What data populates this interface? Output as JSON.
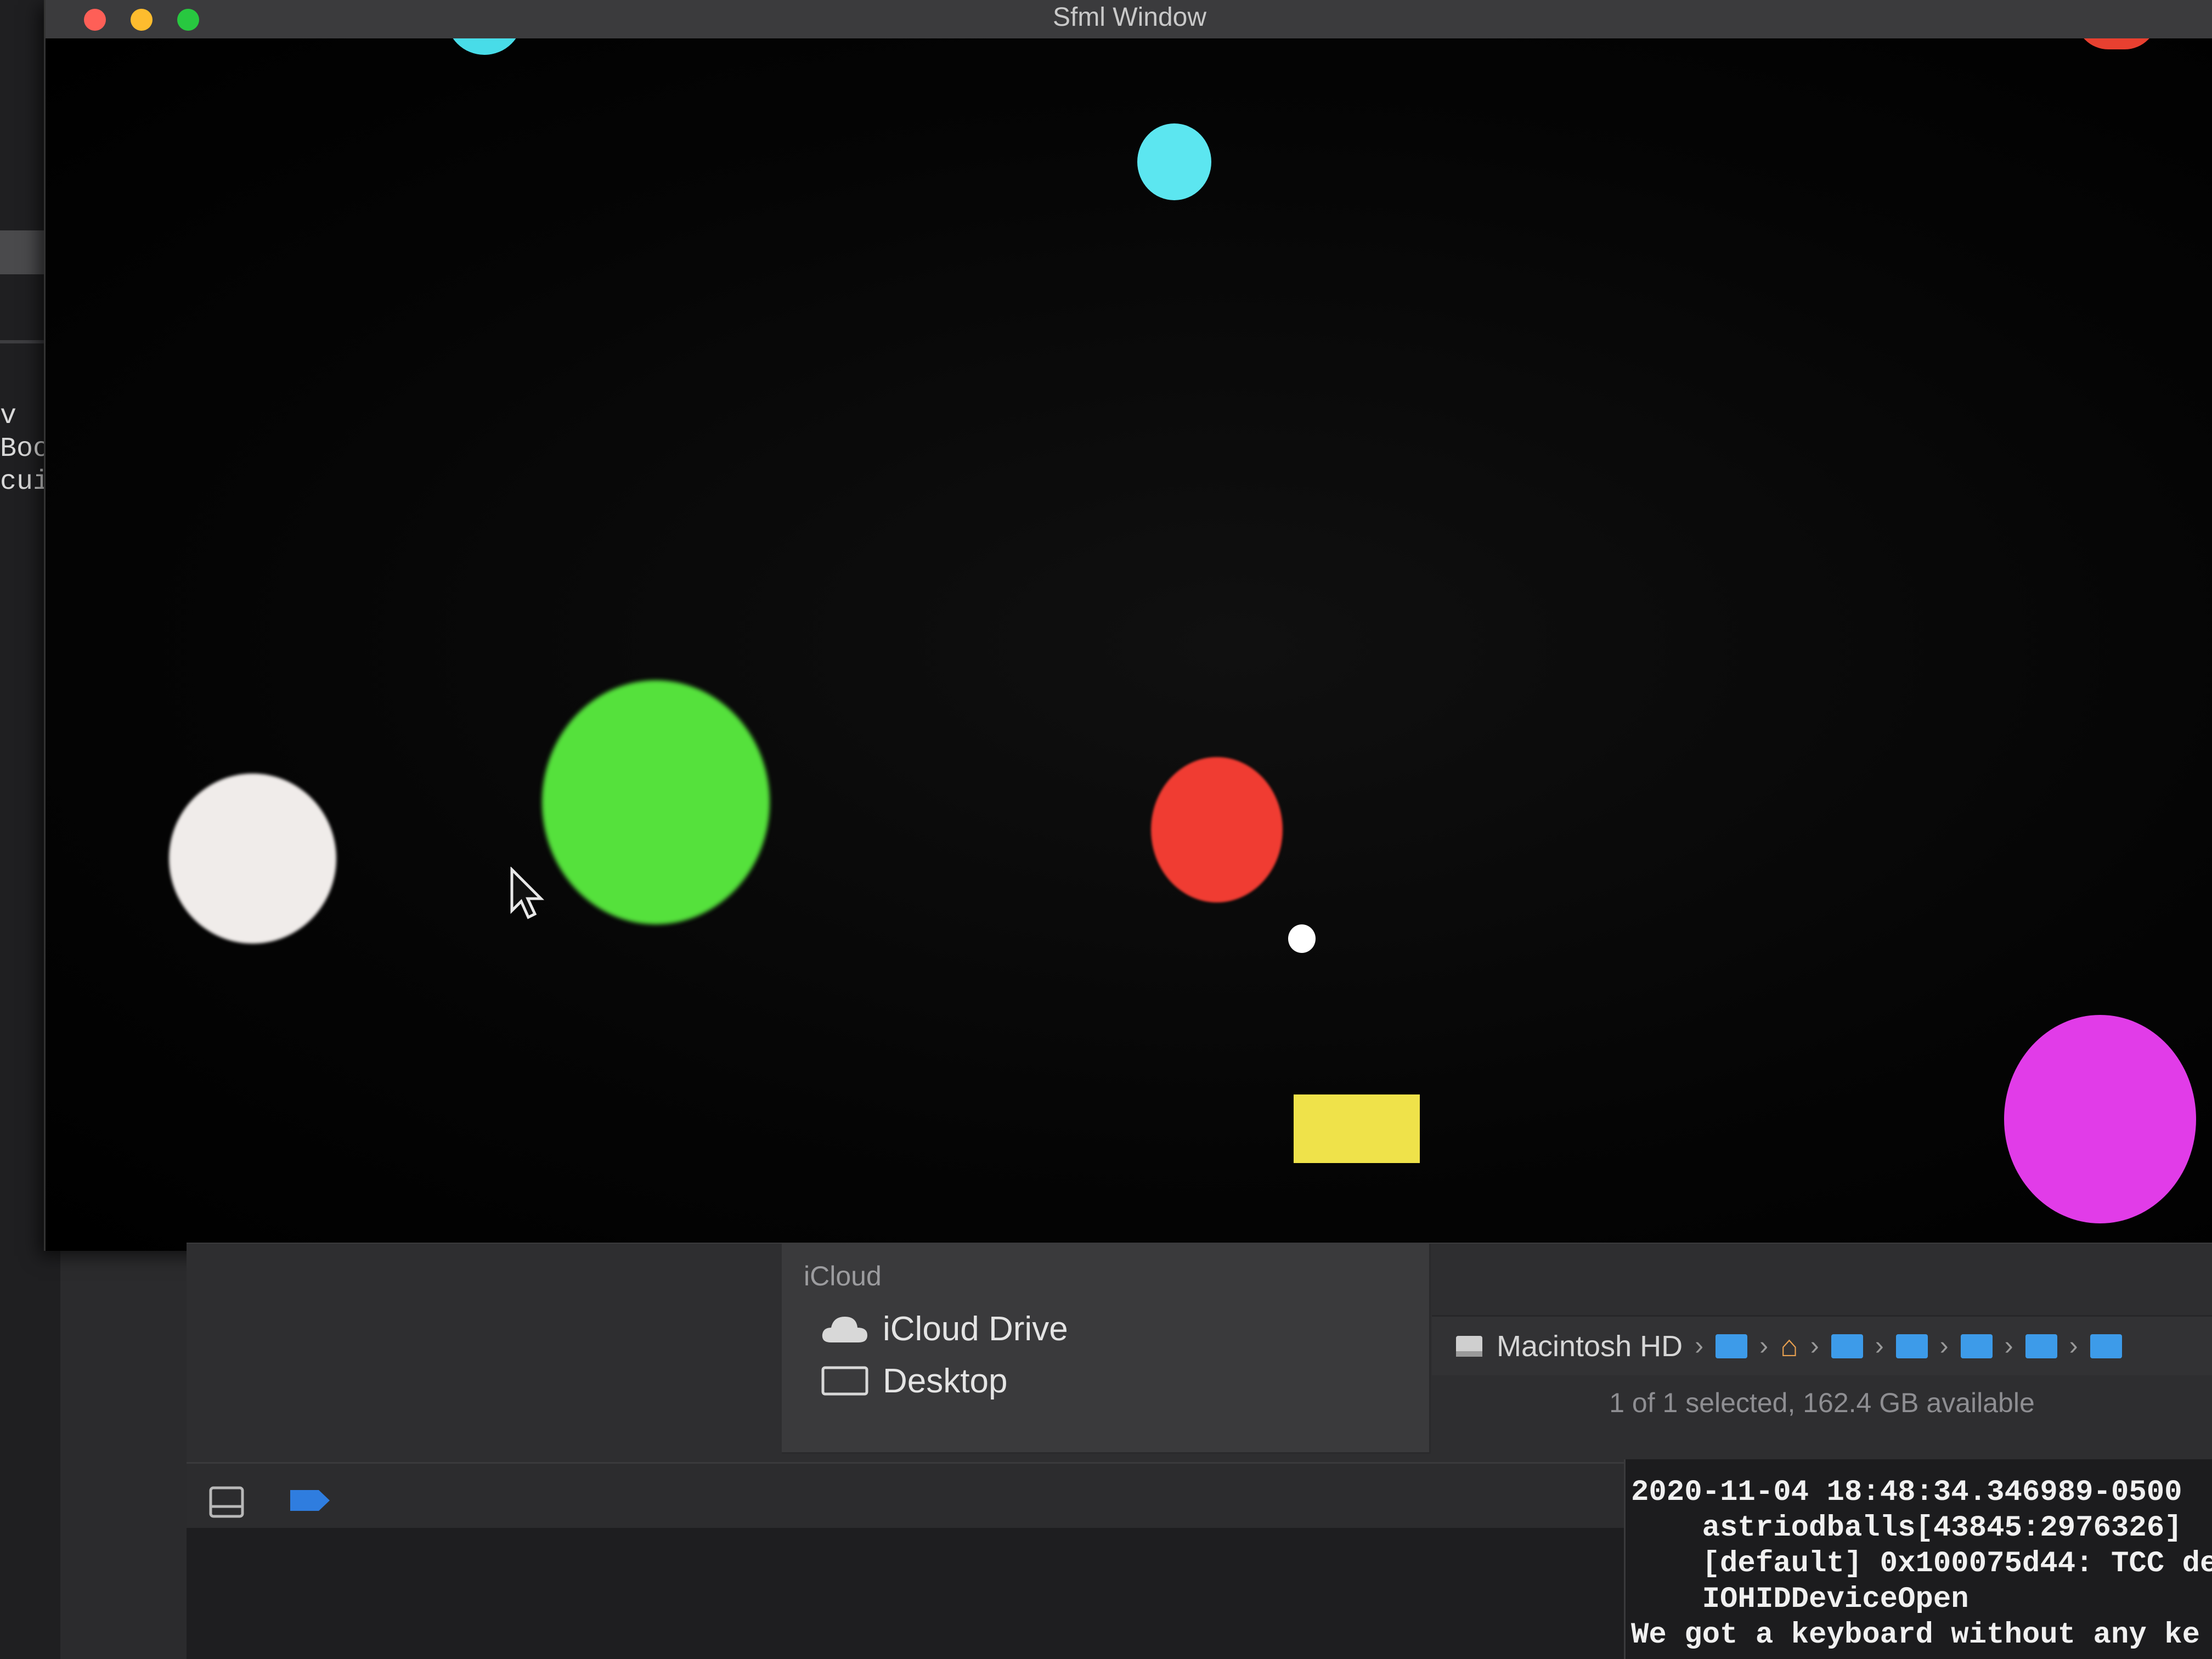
{
  "window": {
    "title": "Sfml Window"
  },
  "background_editor": {
    "code_fragments": [
      "v  !",
      "Boo",
      "cui("
    ]
  },
  "game": {
    "balls": [
      {
        "name": "ball-cyan-top-edge",
        "color": "#48dce8"
      },
      {
        "name": "ball-red-top-edge",
        "color": "#e84030"
      },
      {
        "name": "ball-cyan",
        "color": "#5ce6f0"
      },
      {
        "name": "ball-white",
        "color": "#f0ecea"
      },
      {
        "name": "ball-green",
        "color": "#55e13c"
      },
      {
        "name": "ball-red",
        "color": "#f03c32"
      },
      {
        "name": "ball-small-white",
        "color": "#ffffff"
      },
      {
        "name": "ball-magenta",
        "color": "#e13ce8"
      }
    ],
    "paddle_color": "#efe24a"
  },
  "finder": {
    "sidebar_heading": "iCloud",
    "sidebar_items": [
      {
        "label": "iCloud Drive",
        "icon": "cloud-icon"
      },
      {
        "label": "Desktop",
        "icon": "desktop-icon"
      }
    ],
    "path_root": "Macintosh HD",
    "path_folders": [
      "folder-icon",
      "home-icon",
      "folder-icon",
      "folder-icon",
      "folder-icon",
      "folder-icon",
      "folder-icon"
    ],
    "status": "1 of 1 selected, 162.4 GB available"
  },
  "console": {
    "lines": [
      "2020-11-04 18:48:34.346989-0500",
      "    astriodballs[43845:2976326]",
      "    [default] 0x100075d44: TCC de",
      "    IOHIDDeviceOpen",
      "We got a keyboard without any ke"
    ]
  }
}
